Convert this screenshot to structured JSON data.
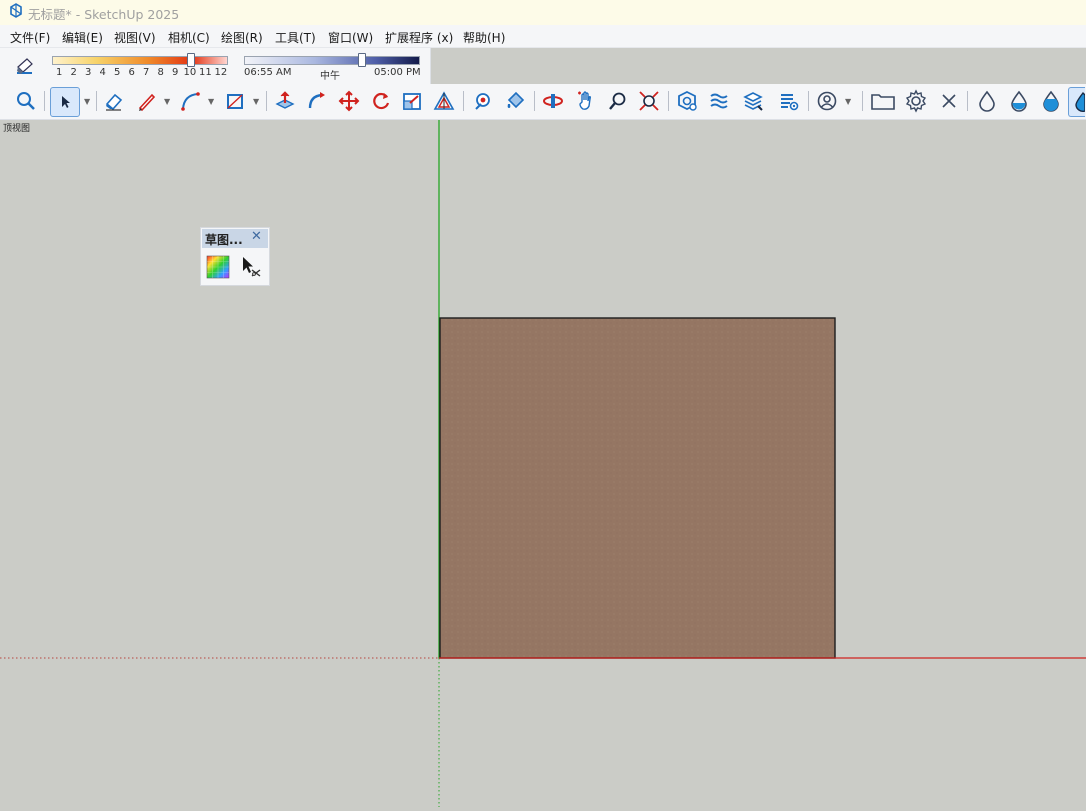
{
  "window": {
    "title": "无标题* - SketchUp 2025"
  },
  "menu": [
    {
      "label": "文件(F)"
    },
    {
      "label": "编辑(E)"
    },
    {
      "label": "视图(V)"
    },
    {
      "label": "相机(C)"
    },
    {
      "label": "绘图(R)"
    },
    {
      "label": "工具(T)"
    },
    {
      "label": "窗口(W)"
    },
    {
      "label": "扩展程序 (x)"
    },
    {
      "label": "帮助(H)"
    }
  ],
  "shadows": {
    "months": [
      "1",
      "2",
      "3",
      "4",
      "5",
      "6",
      "7",
      "8",
      "9",
      "10",
      "11",
      "12"
    ],
    "month_value": 11,
    "time_labels": {
      "start": "06:55 AM",
      "mid": "中午",
      "end": "05:00 PM"
    },
    "time_fraction": 0.67
  },
  "scene_tab": "顶视图",
  "palette": {
    "title": "草图..."
  },
  "colors": {
    "face": "#957663",
    "background": "#cbccc7",
    "x_axis": "#d0231f",
    "y_axis": "#1aa31a",
    "accent": "#1f6fc0"
  },
  "toolbar_icons": [
    "zoom-extents-icon",
    "select-icon",
    "eraser-icon",
    "pencil-line-icon",
    "arc-icon",
    "rectangle-icon",
    "push-pull-icon",
    "follow-me-icon",
    "move-icon",
    "rotate-icon",
    "scale-icon",
    "offset-icon",
    "tape-measure-icon",
    "paint-bucket-icon",
    "orbit-icon",
    "pan-icon",
    "zoom-icon",
    "zoom-window-icon",
    "warehouse-icon",
    "sandbox-icon",
    "layers-icon",
    "extension-icon",
    "profile-icon",
    "folder-icon",
    "settings-icon",
    "close-icon",
    "style-icon",
    "style-half-icon",
    "style-filled-icon",
    "style-active-icon"
  ]
}
